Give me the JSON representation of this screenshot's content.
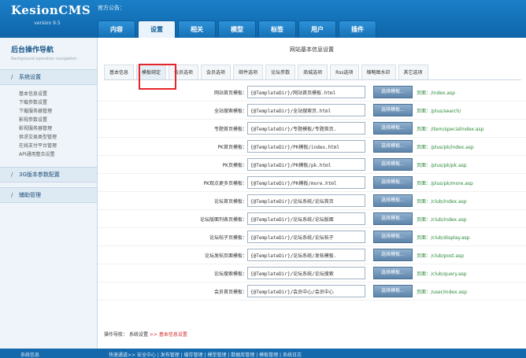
{
  "header": {
    "logo": "KesionCMS",
    "version": "version 9.5",
    "notice": "官方公告：",
    "tabs": [
      {
        "label": "内容"
      },
      {
        "label": "设置"
      },
      {
        "label": "相关"
      },
      {
        "label": "模型"
      },
      {
        "label": "标签"
      },
      {
        "label": "用户"
      },
      {
        "label": "插件"
      }
    ],
    "active_tab": "设置"
  },
  "sidebar": {
    "title": "后台操作导航",
    "subtitle": "Background operation navigation",
    "sections": [
      {
        "label": "系统设置"
      },
      {
        "label": "3G版本参数配置"
      },
      {
        "label": "辅助管理"
      }
    ],
    "items": [
      {
        "label": "基本信息设置"
      },
      {
        "label": "下载参数设置"
      },
      {
        "label": "下载服务器管理"
      },
      {
        "label": "影视参数设置"
      },
      {
        "label": "影视服务器管理"
      },
      {
        "label": "供求交易类型管理"
      },
      {
        "label": "在线支付平台管理"
      },
      {
        "label": "API通用整合设置"
      }
    ]
  },
  "main": {
    "title": "网站基本信息设置",
    "subtabs": [
      {
        "label": "基本信息"
      },
      {
        "label": "模板绑定"
      },
      {
        "label": "会员选项"
      },
      {
        "label": "会员选项"
      },
      {
        "label": "邮件选项"
      },
      {
        "label": "论坛参数"
      },
      {
        "label": "商城选项"
      },
      {
        "label": "Rss选项"
      },
      {
        "label": "缩略图水印"
      },
      {
        "label": "其它选项"
      }
    ],
    "active_subtab": "模板绑定",
    "choose_button": "选择模板...",
    "rows": [
      {
        "label": "网站首页模板：",
        "value": "{@TemplateDir}/网站首页模板.html",
        "page": "页面：/index.asp"
      },
      {
        "label": "全站搜索模板：",
        "value": "{@TemplateDir}/全站搜索页.html",
        "page": "页面：/plus/search/"
      },
      {
        "label": "专题首页模板：",
        "value": "{@TemplateDir}/专题模板/专题首页.",
        "page": "页面：/item/specialindex.asp"
      },
      {
        "label": "PK首页模板：",
        "value": "{@TemplateDir}/PK模板/index.html",
        "page": "页面：/plus/pk/index.asp"
      },
      {
        "label": "PK页模板：",
        "value": "{@TemplateDir}/PK模板/pk.html",
        "page": "页面：/plus/pk/pk.asp"
      },
      {
        "label": "PK观点更多页模板：",
        "value": "{@TemplateDir}/PK模板/more.html",
        "page": "页面：/plus/pk/more.asp"
      },
      {
        "label": "论坛首页模板：",
        "value": "{@TemplateDir}/论坛系统/论坛首页",
        "page": "页面：/club/index.asp"
      },
      {
        "label": "论坛版面列表页模板：",
        "value": "{@TemplateDir}/论坛系统/论坛版面",
        "page": "页面：/club/index.asp"
      },
      {
        "label": "论坛帖子页模板：",
        "value": "{@TemplateDir}/论坛系统/论坛帖子",
        "page": "页面：/club/display.asp"
      },
      {
        "label": "论坛发帖页面模板：",
        "value": "{@TemplateDir}/论坛系统/发帖模板.",
        "page": "页面：/club/post.asp"
      },
      {
        "label": "论坛搜索模板：",
        "value": "{@TemplateDir}/论坛系统/论坛搜索",
        "page": "页面：/club/query.asp"
      },
      {
        "label": "会员首页模板：",
        "value": "{@TemplateDir}/会员中心/会员中心",
        "page": "页面：/user/index.asp"
      }
    ],
    "breadcrumb": {
      "prefix": "操作导航：",
      "path": "系统设置",
      "sep": ">>",
      "current": "基本信息设置"
    }
  },
  "footer": {
    "left": "系统信息",
    "right": "快速通道>> 安全中心 | 发布管理 | 缓存管理 | 模型管理 | 数据库管理 | 模板管理 | 系统日志"
  },
  "colors": {
    "header_blue": "#1a7fc8",
    "highlight_red": "#e5252a",
    "page_link_green": "#2a8a3a"
  }
}
